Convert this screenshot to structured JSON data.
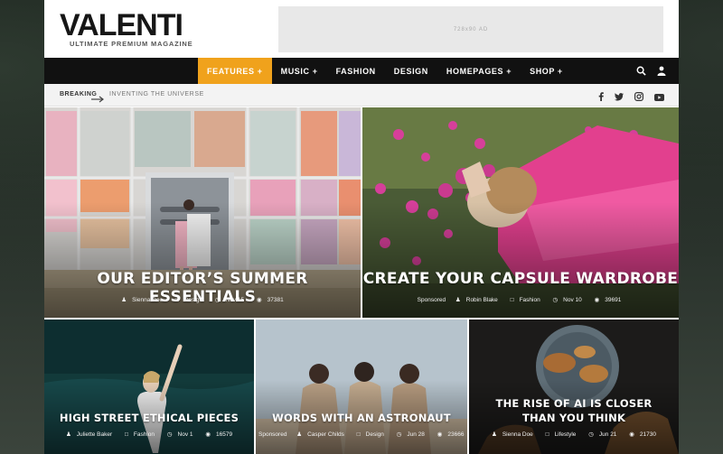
{
  "header": {
    "logo": "VALENTI",
    "tagline": "ULTIMATE PREMIUM MAGAZINE",
    "ad_label": "728x90 AD"
  },
  "nav": {
    "items": [
      {
        "label": "FEATURES +",
        "active": true
      },
      {
        "label": "MUSIC +"
      },
      {
        "label": "FASHION"
      },
      {
        "label": "DESIGN"
      },
      {
        "label": "HOMEPAGES +"
      },
      {
        "label": "SHOP +"
      }
    ],
    "tools": [
      "search-icon",
      "user-icon"
    ],
    "accent_color": "#f0a21c"
  },
  "breaking": {
    "label": "BREAKING",
    "headline": "INVENTING THE UNIVERSE",
    "social": [
      "facebook-icon",
      "twitter-icon",
      "instagram-icon",
      "youtube-icon"
    ]
  },
  "posts": [
    {
      "title": "OUR EDITOR’S SUMMER ESSENTIALS",
      "sponsored": "",
      "author": "Sienna Doe",
      "category": "Design",
      "date": "Nov 15",
      "views": "37381"
    },
    {
      "title": "CREATE YOUR CAPSULE WARDROBE",
      "sponsored": "Sponsored",
      "author": "Robin Blake",
      "category": "Fashion",
      "date": "Nov 10",
      "views": "39691"
    },
    {
      "title": "HIGH STREET ETHICAL PIECES",
      "sponsored": "",
      "author": "Juliette Baker",
      "category": "Fashion",
      "date": "Nov 1",
      "views": "16579"
    },
    {
      "title": "WORDS WITH AN ASTRONAUT",
      "sponsored": "Sponsored",
      "author": "Casper Childs",
      "category": "Design",
      "date": "Jun 28",
      "views": "23666"
    },
    {
      "title": "THE RISE OF AI IS CLOSER THAN YOU THINK",
      "sponsored": "",
      "author": "Sienna Doe",
      "category": "Lifestyle",
      "date": "Jun 21",
      "views": "21730"
    }
  ]
}
